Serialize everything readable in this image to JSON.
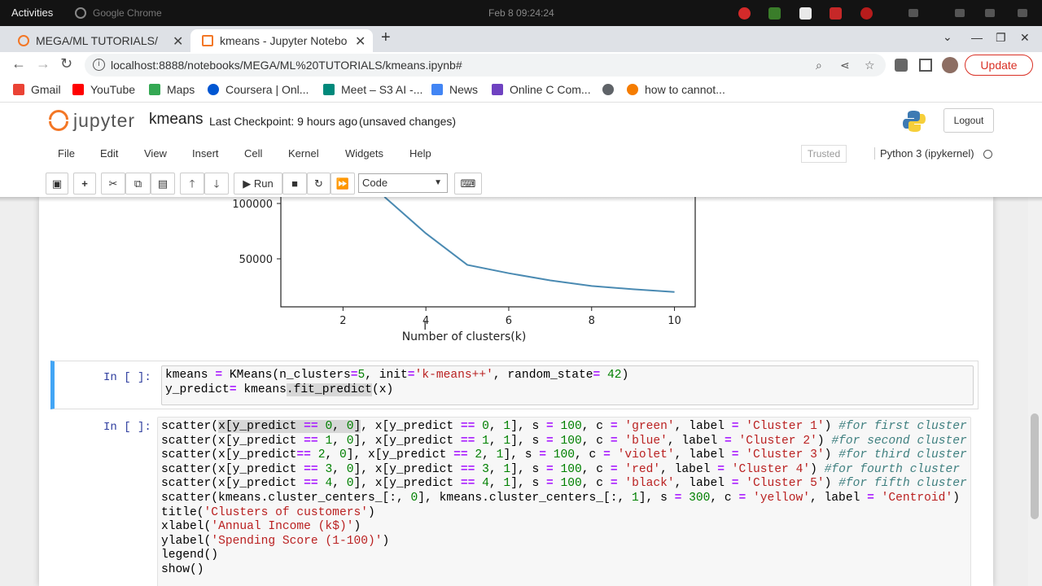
{
  "os_topbar": {
    "activities": "Activities",
    "app_name": "Google Chrome",
    "clock": "Feb 8  09:24:24"
  },
  "browser": {
    "tabs": [
      {
        "title": "MEGA/ML TUTORIALS/",
        "active": false
      },
      {
        "title": "kmeans - Jupyter Notebo",
        "active": true
      }
    ],
    "url": "localhost:8888/notebooks/MEGA/ML%20TUTORIALS/kmeans.ipynb#",
    "update_label": "Update",
    "bookmarks": [
      {
        "label": "Gmail",
        "color": "#ea4335"
      },
      {
        "label": "YouTube",
        "color": "#ff0000"
      },
      {
        "label": "Maps",
        "color": "#34a853"
      },
      {
        "label": "Coursera | Onl...",
        "color": "#0056d2"
      },
      {
        "label": "Meet – S3 AI -...",
        "color": "#00897b"
      },
      {
        "label": "News",
        "color": "#4285f4"
      },
      {
        "label": "Online C Com...",
        "color": "#6f42c1"
      },
      {
        "label": "",
        "color": "#5f6368"
      },
      {
        "label": "how to cannot...",
        "color": "#f57c00"
      }
    ]
  },
  "jupyter": {
    "logo_text": "jupyter",
    "notebook_name": "kmeans",
    "checkpoint": "Last Checkpoint: 9 hours ago",
    "unsaved": "(unsaved changes)",
    "logout": "Logout",
    "menu": [
      "File",
      "Edit",
      "View",
      "Insert",
      "Cell",
      "Kernel",
      "Widgets",
      "Help"
    ],
    "trusted": "Trusted",
    "kernel": "Python 3 (ipykernel)",
    "run_label": "Run",
    "cell_type": "Code"
  },
  "chart_data": {
    "type": "line",
    "xlabel": "Number of clusters(k)",
    "ylabel": "",
    "x_ticks": [
      "2",
      "4",
      "6",
      "8",
      "10"
    ],
    "y_ticks": [
      "50000",
      "100000"
    ],
    "x": [
      3,
      4,
      5,
      6,
      7,
      8,
      9,
      10
    ],
    "y": [
      106000,
      73000,
      44500,
      37000,
      30500,
      25500,
      22500,
      20000
    ],
    "xlim": [
      0.5,
      10.5
    ],
    "color": "#4a8ab2"
  },
  "cells": [
    {
      "prompt": "In [ ]:",
      "lines": [
        "kmeans = KMeans(n_clusters=5, init='k-means++', random_state= 42)",
        "y_predict= kmeans.fit_predict(x)"
      ]
    },
    {
      "prompt": "In [ ]:",
      "lines": [
        "scatter(x[y_predict == 0, 0], x[y_predict == 0, 1], s = 100, c = 'green', label = 'Cluster 1') #for first cluster",
        "scatter(x[y_predict == 1, 0], x[y_predict == 1, 1], s = 100, c = 'blue', label = 'Cluster 2') #for second cluster",
        "scatter(x[y_predict== 2, 0], x[y_predict == 2, 1], s = 100, c = 'violet', label = 'Cluster 3') #for third cluster",
        "scatter(x[y_predict == 3, 0], x[y_predict == 3, 1], s = 100, c = 'red', label = 'Cluster 4') #for fourth cluster",
        "scatter(x[y_predict == 4, 0], x[y_predict == 4, 1], s = 100, c = 'black', label = 'Cluster 5') #for fifth cluster",
        "scatter(kmeans.cluster_centers_[:, 0], kmeans.cluster_centers_[:, 1], s = 300, c = 'yellow', label = 'Centroid')",
        "title('Clusters of customers')",
        "xlabel('Annual Income (k$)')",
        "ylabel('Spending Score (1-100)')",
        "legend()",
        "show()"
      ]
    }
  ]
}
